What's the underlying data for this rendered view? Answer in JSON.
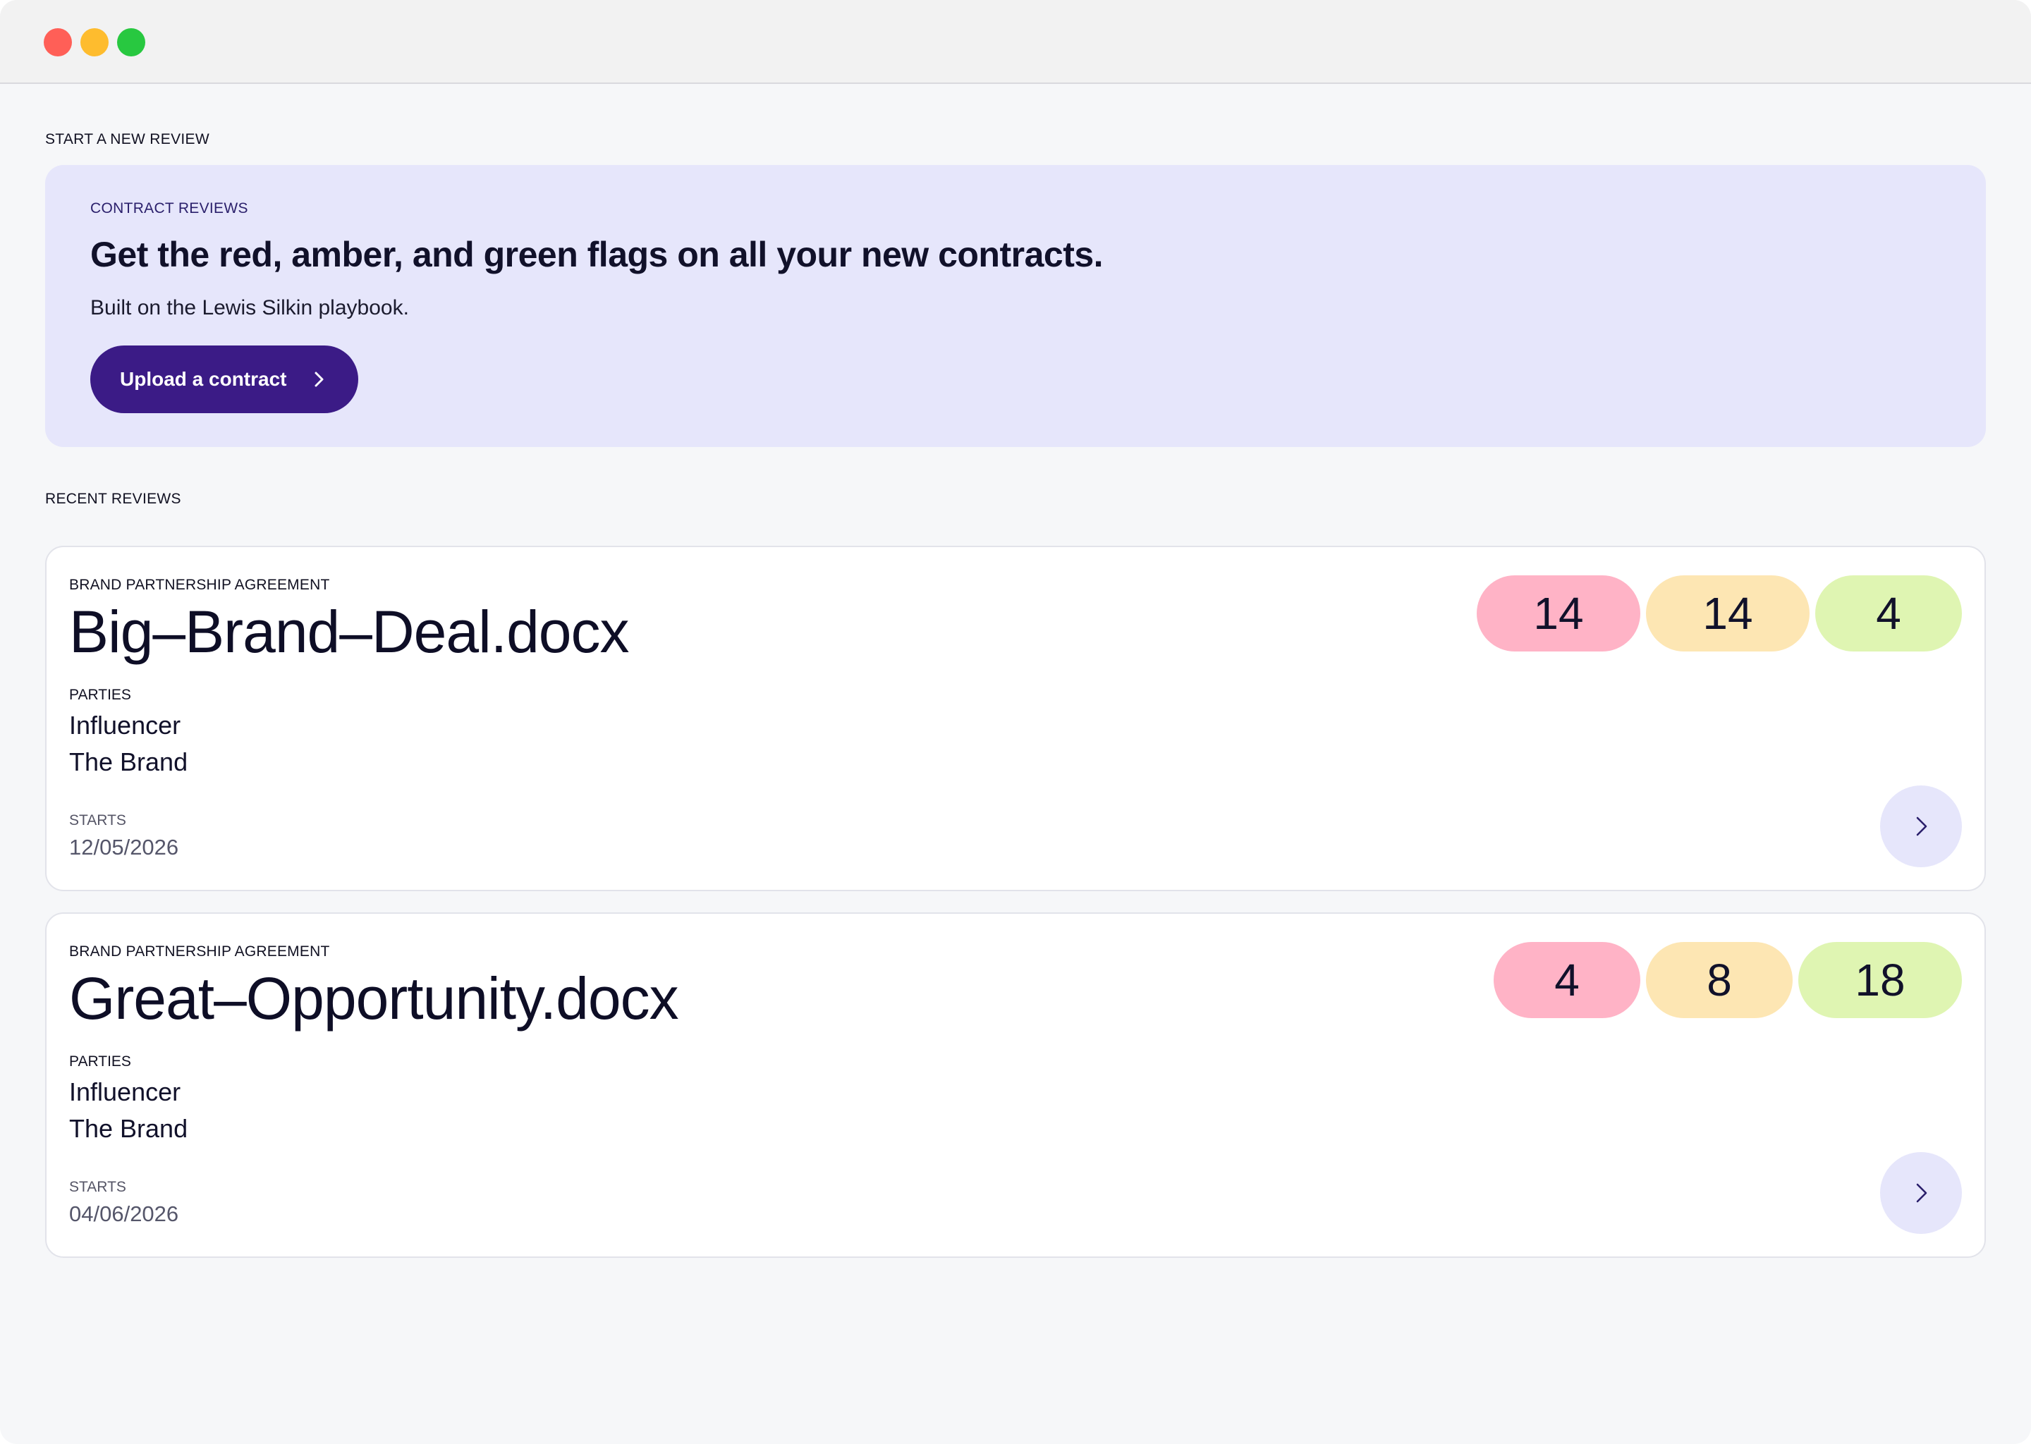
{
  "new_review": {
    "section_label": "START A NEW REVIEW",
    "eyebrow": "CONTRACT REVIEWS",
    "title": "Get the red, amber, and green flags on all your new contracts.",
    "subtitle": "Built on the Lewis Silkin playbook.",
    "upload_label": "Upload a contract"
  },
  "recent": {
    "section_label": "RECENT REVIEWS",
    "reviews": [
      {
        "type": "BRAND PARTNERSHIP AGREEMENT",
        "file": "Big–Brand–Deal.docx",
        "parties_label": "PARTIES",
        "parties": [
          "Influencer",
          "The Brand"
        ],
        "starts_label": "STARTS",
        "starts": "12/05/2026",
        "flags": {
          "red": "14",
          "amber": "14",
          "green": "4"
        }
      },
      {
        "type": "BRAND PARTNERSHIP AGREEMENT",
        "file": "Great–Opportunity.docx",
        "parties_label": "PARTIES",
        "parties": [
          "Influencer",
          "The Brand"
        ],
        "starts_label": "STARTS",
        "starts": "04/06/2026",
        "flags": {
          "red": "4",
          "amber": "8",
          "green": "18"
        }
      }
    ]
  },
  "colors": {
    "accent": "#3b1b86",
    "hero_bg": "#e6e6fb",
    "flag_red": "#ffb3c6",
    "flag_amber": "#fde6b3",
    "flag_green": "#dff5b2"
  },
  "icons": {
    "upload_chevron": "chevron-right-icon",
    "open_chevron": "chevron-right-icon"
  }
}
